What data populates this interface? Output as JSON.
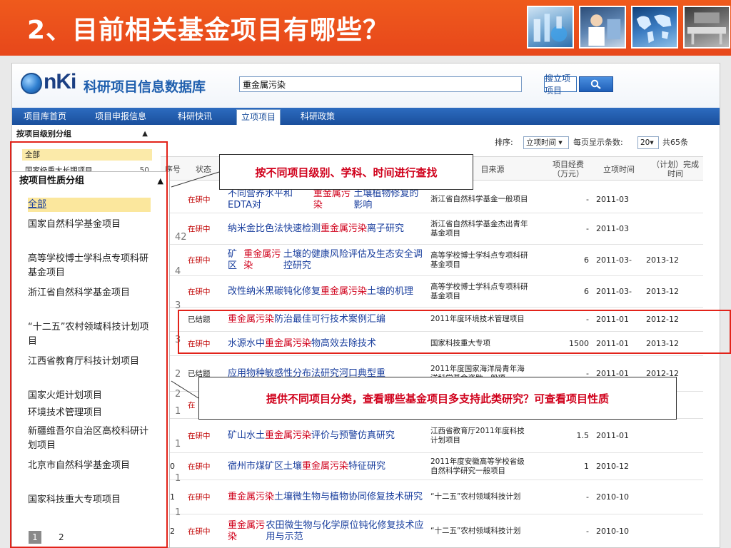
{
  "slide": {
    "title": "2、目前相关基金项目有哪些？"
  },
  "cnki": {
    "logo_text": "nKi",
    "db_title": "科研项目信息数据库",
    "search_value": "重金属污染",
    "search_button": "搜立项项目"
  },
  "nav": {
    "items": [
      "项目库首页",
      "项目申报信息",
      "科研快讯",
      "立项项目",
      "科研政策"
    ]
  },
  "group_panel": {
    "heading": "按项目级别分组",
    "rows": [
      {
        "label": "全部",
        "count": ""
      },
      {
        "label": "国家级重大长期项目",
        "count": "50"
      }
    ]
  },
  "results": {
    "sort_label": "排序:",
    "sort_value": "立项时间",
    "page_size_label": "每页显示条数:",
    "page_size_value": "20",
    "total_label": "共65条",
    "headers": {
      "no": "序号",
      "status": "状态",
      "source": "目来源",
      "amount": "项目经费（万元）",
      "start": "立项时间",
      "end": "（计划）完成时间"
    },
    "rows": [
      {
        "no": "1",
        "status": "在研中",
        "title": "不同营养水平和EDTA对重金属污染土壤植物修复的影响",
        "source": "浙江省自然科学基金一般项目",
        "amount": "-",
        "start": "2011-03",
        "end": ""
      },
      {
        "no": "2",
        "status": "在研中",
        "title": "纳米金比色法快速检测重金属污染离子研究",
        "source": "浙江省自然科学基金杰出青年基金项目",
        "amount": "-",
        "start": "2011-03",
        "end": ""
      },
      {
        "no": "3",
        "status": "在研中",
        "title": "矿区重金属污染土壤的健康风险评估及生态安全调控研究",
        "source": "高等学校博士学科点专项科研基金项目",
        "amount": "6",
        "start": "2011-03-",
        "end": "2013-12"
      },
      {
        "no": "4",
        "status": "在研中",
        "title": "改性纳米黑碳钝化修复重金属污染土壤的机理",
        "source": "高等学校博士学科点专项科研基金项目",
        "amount": "6",
        "start": "2011-03-",
        "end": "2013-12"
      },
      {
        "no": "5",
        "status": "已结题",
        "title": "重金属污染防治最佳可行技术案例汇编",
        "source": "2011年度环境技术管理项目",
        "amount": "-",
        "start": "2011-01",
        "end": "2012-12"
      },
      {
        "no": "6",
        "status": "在研中",
        "title": "水源水中重金属污染物高效去除技术",
        "source": "国家科技重大专项",
        "amount": "1500",
        "start": "2011-01",
        "end": "2013-12"
      },
      {
        "no": "7",
        "status": "已结题",
        "title": "应用物种敏感性分布法研究河口典型重",
        "source": "2011年度国家海洋局青年海洋科学基金资助一般项",
        "amount": "-",
        "start": "2011-01",
        "end": "2012-12"
      },
      {
        "no": "8",
        "status": "在",
        "title": "",
        "source": "",
        "amount": "",
        "start": "",
        "end": ""
      },
      {
        "no": "9",
        "status": "在研中",
        "title": "矿山水土重金属污染评价与预警仿真研究",
        "source": "江西省教育厅2011年度科技计划项目",
        "amount": "1.5",
        "start": "2011-01",
        "end": ""
      },
      {
        "no": "10",
        "status": "在研中",
        "title": "宿州市煤矿区土壤重金属污染特征研究",
        "source": "2011年度安徽高等学校省级自然科学研究一般项目",
        "amount": "1",
        "start": "2010-12",
        "end": ""
      },
      {
        "no": "11",
        "status": "在研中",
        "title": "重金属污染土壤微生物与植物协同修复技术研究",
        "source": "“十二五”农村领域科技计划",
        "amount": "-",
        "start": "2010-10",
        "end": ""
      },
      {
        "no": "12",
        "status": "在研中",
        "title": "重金属污染农田微生物与化学原位钝化修复技术应用与示范",
        "source": "“十二五”农村领域科技计划",
        "amount": "-",
        "start": "2010-10",
        "end": ""
      }
    ]
  },
  "overlay": {
    "heading": "按项目性质分组",
    "items": [
      {
        "label": "全部",
        "count": ""
      },
      {
        "label": "国家自然科学基金项目",
        "count": "42"
      },
      {
        "label": "高等学校博士学科点专项科研基金项目",
        "count": "4"
      },
      {
        "label": "浙江省自然科学基金项目",
        "count": "3"
      },
      {
        "label": "“十二五”农村领域科技计划项目",
        "count": "3"
      },
      {
        "label": "江西省教育厅科技计划项目",
        "count": "2"
      },
      {
        "label": "国家火炬计划项目",
        "count": "2"
      },
      {
        "label": "环境技术管理项目",
        "count": "1"
      },
      {
        "label": "新疆维吾尔自治区高校科研计划项目",
        "count": "1"
      },
      {
        "label": "北京市自然科学基金项目",
        "count": "1"
      },
      {
        "label": "国家科技重大专项项目",
        "count": "1"
      }
    ],
    "pager_current": "1",
    "pager_next": "2"
  },
  "callouts": {
    "first": "按不同项目级别、学科、时间进行查找",
    "second": "提供不同项目分类，查看哪些基金项目多支持此类研究？可查看项目性质"
  },
  "colors": {
    "header_orange": "#e7471b",
    "highlight_red": "#e2231a",
    "callout_text": "#d0001b",
    "nav_blue": "#1a4f9c",
    "keyword_red": "#d0001b"
  }
}
